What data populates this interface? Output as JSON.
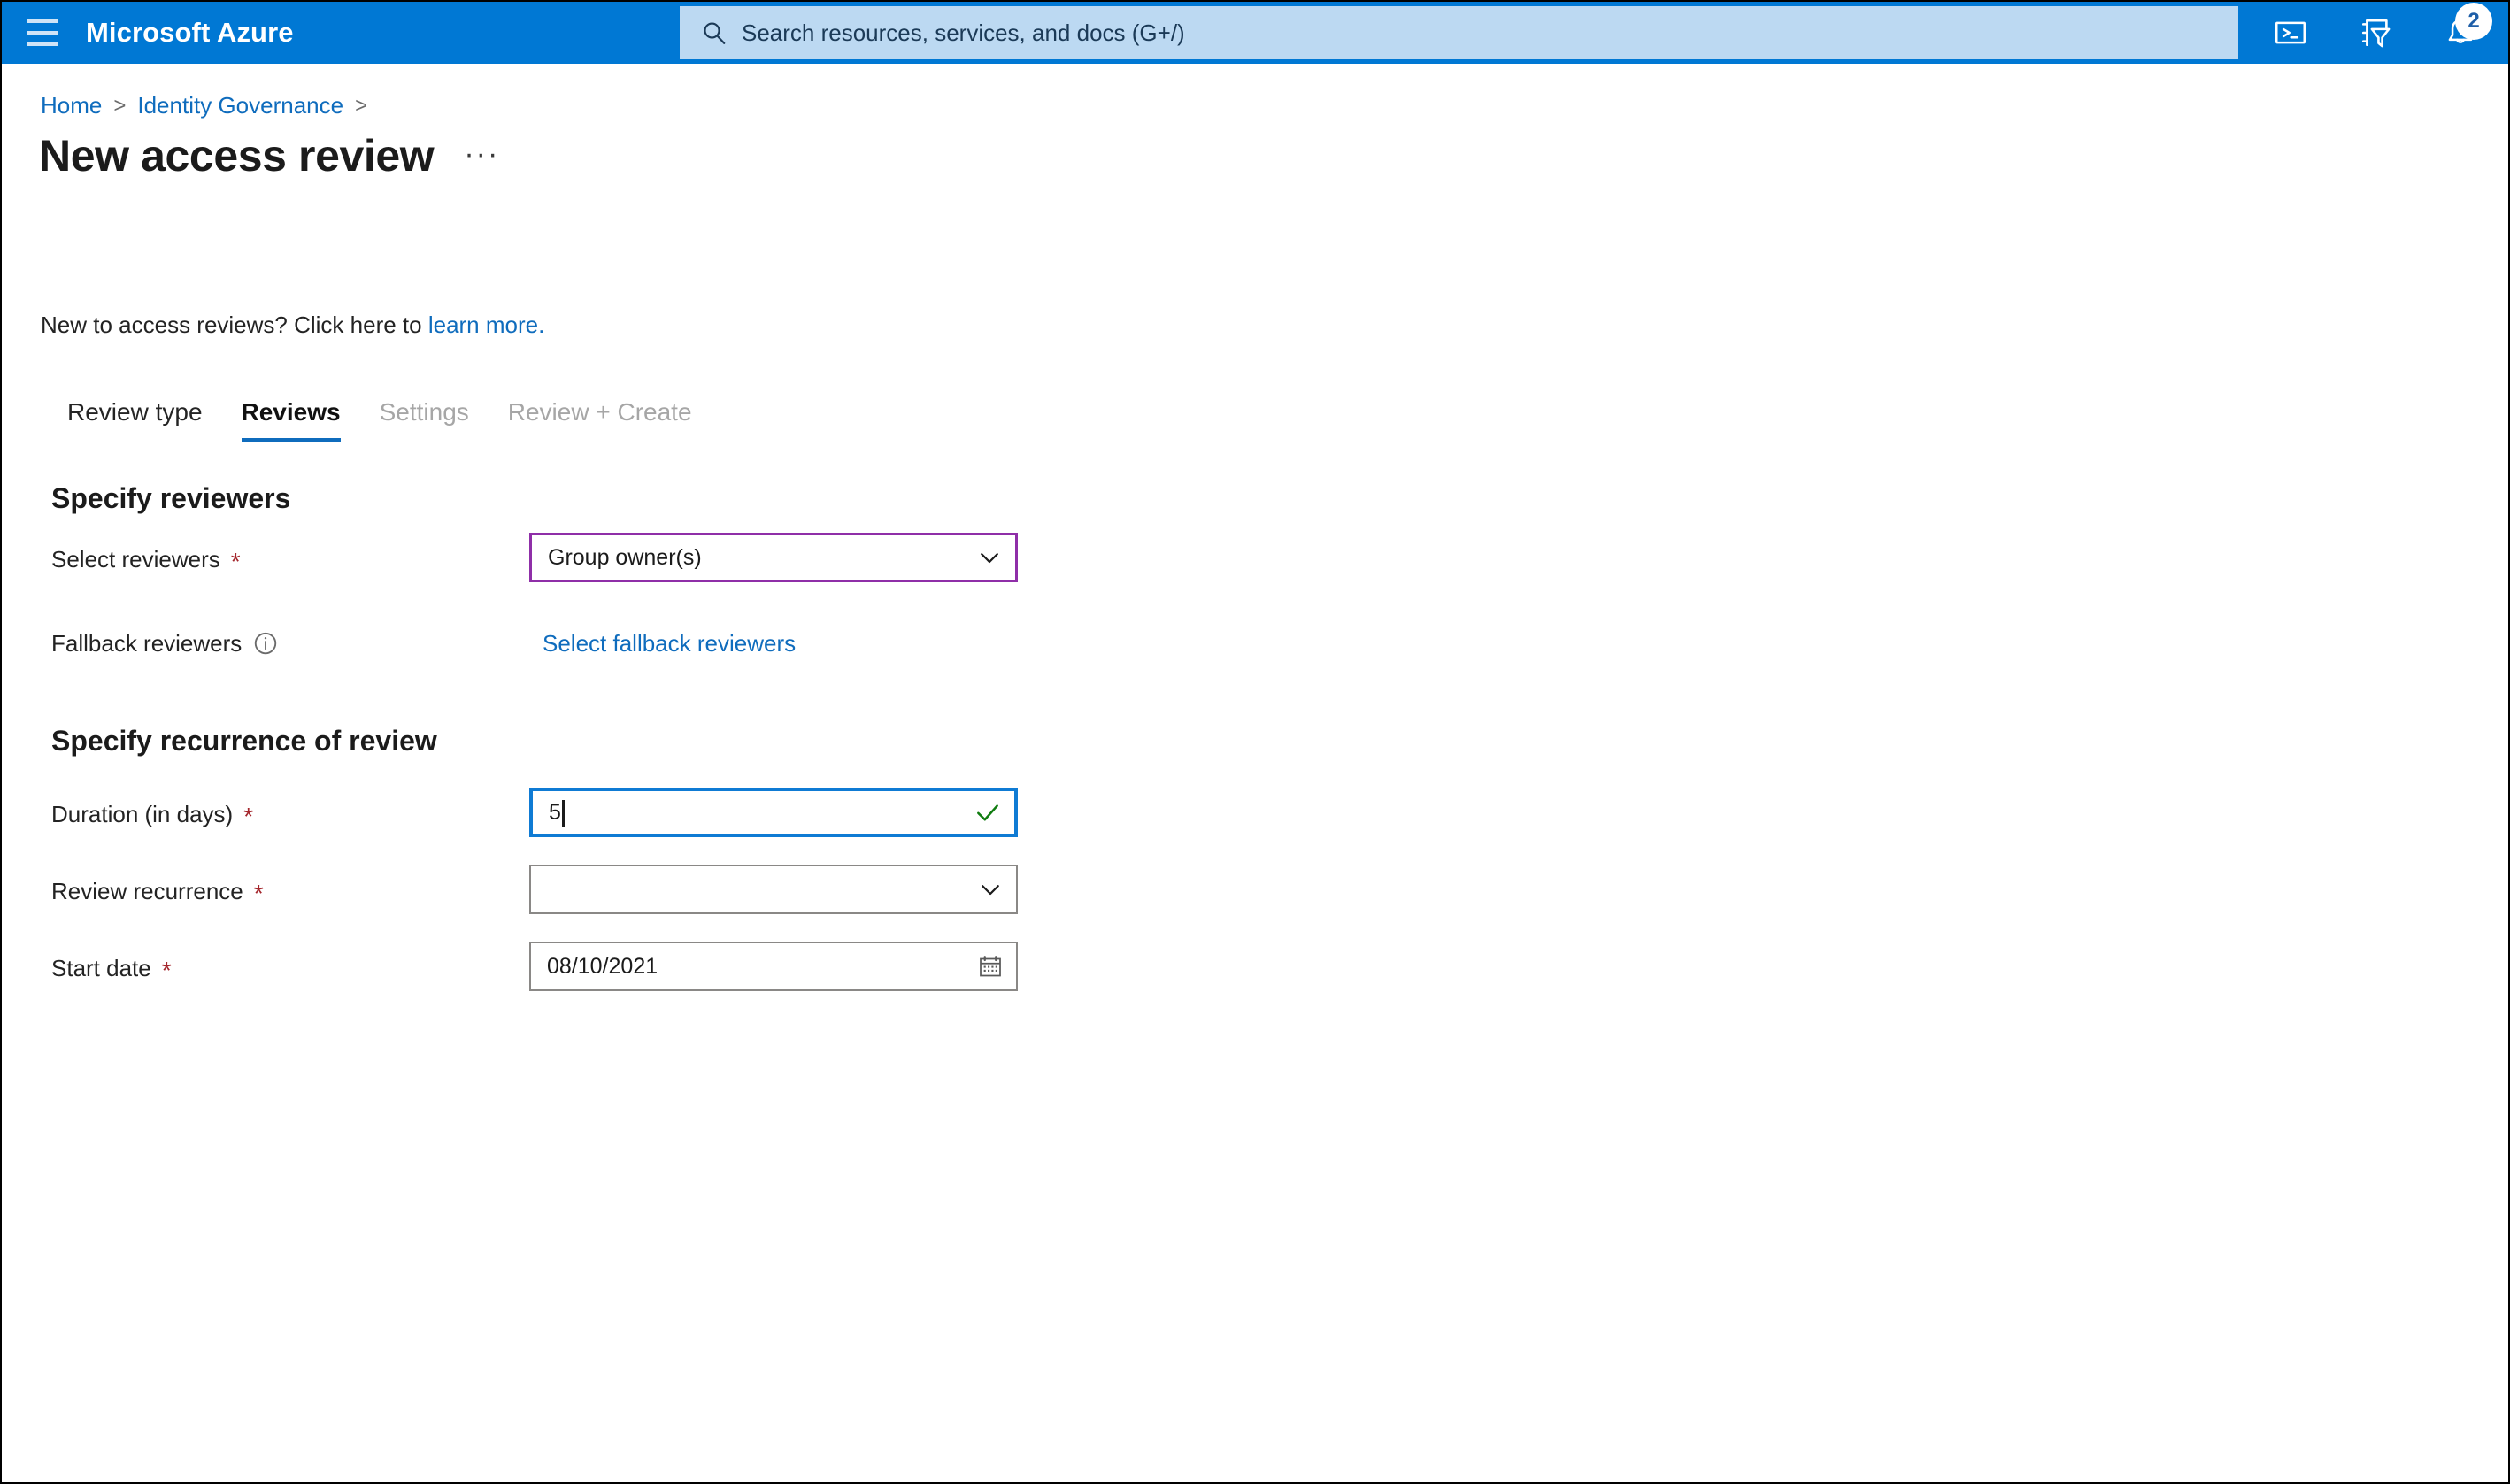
{
  "topbar": {
    "menu_icon": "hamburger-icon",
    "brand": "Microsoft Azure",
    "search": {
      "icon": "search-icon",
      "placeholder": "Search resources, services, and docs (G+/)"
    },
    "actions": [
      {
        "name": "cloud-shell-icon",
        "label": "Cloud Shell"
      },
      {
        "name": "directories-subscriptions-icon",
        "label": "Directories + subscriptions"
      },
      {
        "name": "notifications-bell-icon",
        "label": "Notifications",
        "badge": "2"
      }
    ],
    "accent_color": "#0078D4",
    "search_bg": "#BCD9F2"
  },
  "breadcrumb": {
    "items": [
      {
        "label": "Home",
        "separator": ">"
      },
      {
        "label": "Identity Governance",
        "separator": ">"
      }
    ]
  },
  "page": {
    "title": "New access review",
    "more_menu": "···",
    "intro_prefix": "New to access reviews? Click here to ",
    "intro_link": "learn more."
  },
  "tabs": [
    {
      "label": "Review type",
      "state": "enabled"
    },
    {
      "label": "Reviews",
      "state": "active"
    },
    {
      "label": "Settings",
      "state": "disabled"
    },
    {
      "label": "Review + Create",
      "state": "disabled"
    }
  ],
  "sections": [
    {
      "heading": "Specify reviewers",
      "fields": [
        {
          "label": "Select reviewers",
          "required": "*",
          "control": "dropdown",
          "value": "Group owner(s)",
          "border_state": "purple",
          "border_color": "#8F2FA8"
        },
        {
          "label": "Fallback reviewers",
          "required": "",
          "control": "link",
          "info_icon": "info-icon",
          "link_label": "Select fallback reviewers"
        }
      ]
    },
    {
      "heading": "Specify recurrence of review",
      "fields": [
        {
          "label": "Duration (in days)",
          "required": "*",
          "control": "text",
          "value": "5",
          "border_state": "focused",
          "border_color": "#0F7BD4",
          "validation": "valid-check",
          "validation_color": "#107C10"
        },
        {
          "label": "Review recurrence",
          "required": "*",
          "control": "dropdown",
          "value": "",
          "border_state": "default",
          "border_color": "#8A8886"
        },
        {
          "label": "Start date",
          "required": "*",
          "control": "date",
          "value": "08/10/2021",
          "border_state": "default",
          "border_color": "#8A8886"
        }
      ]
    }
  ],
  "colors": {
    "link": "#0F6CBD",
    "required_asterisk": "#A4262C",
    "text": "#1B1B1B",
    "disabled_text": "#A6A6A6"
  }
}
